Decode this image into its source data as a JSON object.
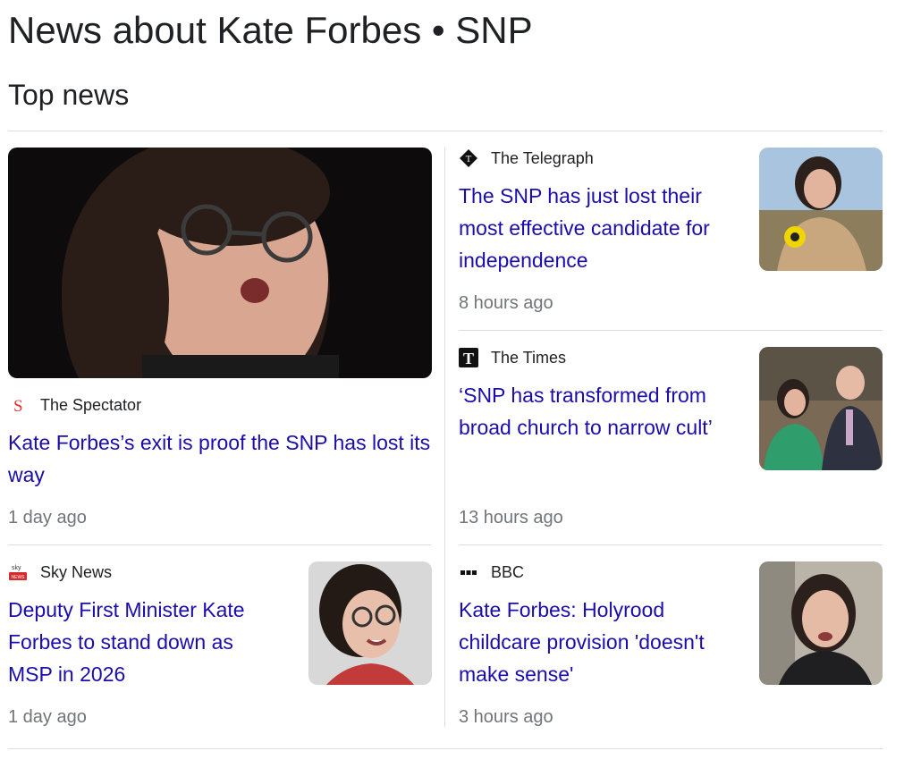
{
  "page": {
    "heading": "News about Kate Forbes • SNP",
    "section_title": "Top news"
  },
  "articles": [
    {
      "source": "The Spectator",
      "source_icon": "spectator-s-logo-icon",
      "headline": "Kate Forbes’s exit is proof the SNP has lost its way",
      "time": "1 day ago",
      "thumbnail": "kate-forbes-speaking-photo"
    },
    {
      "source": "The Telegraph",
      "source_icon": "telegraph-diamond-logo-icon",
      "headline": "The SNP has just lost their most effective candidate for independence",
      "time": "8 hours ago",
      "thumbnail": "kate-forbes-with-rosette-photo"
    },
    {
      "source": "The Times",
      "source_icon": "times-t-logo-icon",
      "headline": "‘SNP has transformed from broad church to narrow cult’",
      "time": "13 hours ago",
      "thumbnail": "kate-forbes-and-john-swinney-photo"
    },
    {
      "source": "Sky News",
      "source_icon": "sky-news-logo-icon",
      "headline": "Deputy First Minister Kate Forbes to stand down as MSP in 2026",
      "time": "1 day ago",
      "thumbnail": "kate-forbes-smiling-photo"
    },
    {
      "source": "BBC",
      "source_icon": "bbc-dots-logo-icon",
      "headline": "Kate Forbes: Holyrood childcare provision 'doesn't make sense'",
      "time": "3 hours ago",
      "thumbnail": "kate-forbes-portrait-photo"
    }
  ],
  "colors": {
    "link": "#1a0dab",
    "meta": "#70757a",
    "divider": "#dadce0",
    "spectator_red": "#e2342c"
  }
}
